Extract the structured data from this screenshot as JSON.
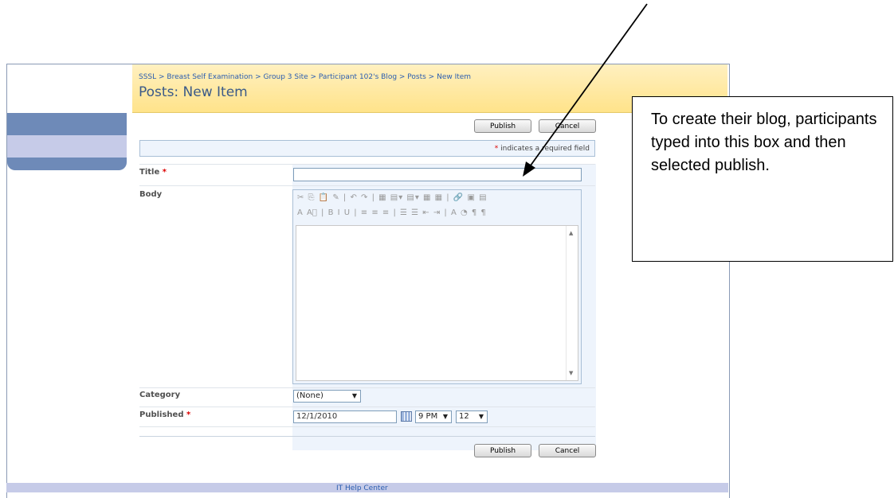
{
  "breadcrumb": "SSSL > Breast Self Examination > Group 3 Site > Participant 102's Blog > Posts > New Item",
  "page_title": "Posts: New Item",
  "buttons": {
    "publish": "Publish",
    "cancel": "Cancel"
  },
  "required_note": {
    "star": "*",
    "text": " indicates a required field"
  },
  "fields": {
    "title_label": "Title",
    "body_label": "Body",
    "category_label": "Category",
    "published_label": "Published",
    "required_star": "*",
    "category_value": "(None)",
    "published_date": "12/1/2010",
    "published_hour": "9 PM",
    "published_minute": "12"
  },
  "editor": {
    "toolbar_row1": "✂ ⎘ 📋 ✎ | ↶ ↷ | ▦ ▤▾ ▤▾ ▦ ▦ | 🔗 ▣ ▤",
    "toolbar_row2": "A A⃞ | B I U | ≡ ≡ ≡ | ☰ ☰ ⇤ ⇥ | A ◔ ¶ ¶"
  },
  "footer_text": "IT Help Center",
  "callout": {
    "text": "To create their blog, participants typed into this box and then selected publish."
  }
}
